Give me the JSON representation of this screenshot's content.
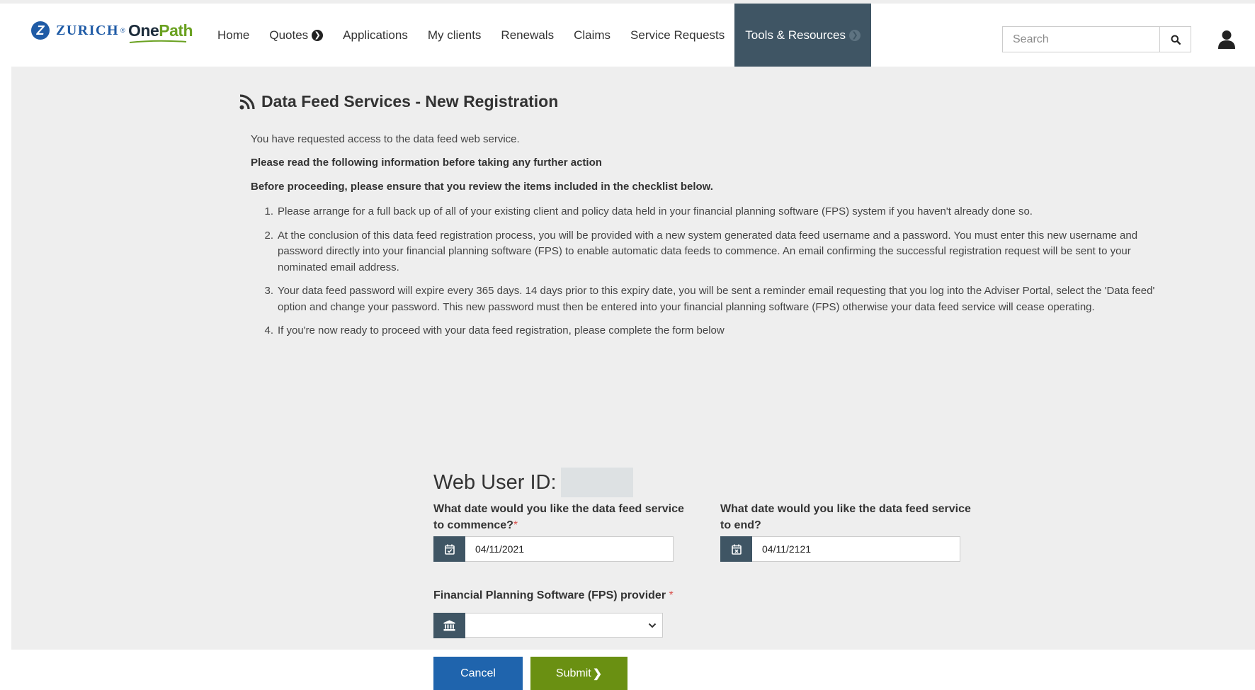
{
  "brand": {
    "zurich_mark": "Z",
    "zurich_name": "ZURICH",
    "zurich_reg": "®",
    "onepath_one": "One",
    "onepath_path": "Path",
    "zurich_color": "#1f5ba6",
    "onepath_green": "#6aa121"
  },
  "nav": {
    "items": [
      {
        "label": "Home"
      },
      {
        "label": "Quotes",
        "has_arrow": true
      },
      {
        "label": "Applications"
      },
      {
        "label": "My clients"
      },
      {
        "label": "Renewals"
      },
      {
        "label": "Claims"
      },
      {
        "label": "Service Requests"
      },
      {
        "label": "Tools & Resources",
        "has_arrow": true,
        "active": true
      }
    ],
    "active_color": "#3f5564"
  },
  "search": {
    "placeholder": "Search",
    "icon": "search-icon"
  },
  "user": {
    "icon": "user-icon"
  },
  "page": {
    "title": "Data Feed Services - New Registration",
    "title_icon": "rss-icon",
    "intro": "You have requested access to the data feed web service.",
    "notice": "Please read the following information before taking any further action",
    "checklist_heading": "Before proceeding, please ensure that you review the items included in the checklist below.",
    "checklist": [
      {
        "num": "1.",
        "text": "Please arrange for a full back up of all of your existing client and policy data held in your financial planning software (FPS) system if you haven't already done so."
      },
      {
        "num": "2.",
        "text": "At the conclusion of this data feed registration process, you will be provided with a new system generated data feed username and a password. You must enter this new username and password directly into your financial planning software (FPS) to enable automatic data feeds to commence. An email confirming the successful registration request will be sent to your nominated email address."
      },
      {
        "num": "3.",
        "text": "Your data feed password will expire every 365 days. 14 days prior to this expiry date, you will be sent a reminder email requesting that you log into the Adviser Portal, select the 'Data feed' option and change your password. This new password must then be entered into your financial planning software (FPS) otherwise your data feed service will cease operating."
      },
      {
        "num": "4.",
        "text": "If you're now ready to proceed with your data feed registration, please complete the form below"
      }
    ]
  },
  "form": {
    "web_user_label": "Web User ID:",
    "web_user_value": "",
    "start_label": "What date would you like the data feed service to commence?",
    "start_required": "*",
    "start_value": "04/11/2021",
    "start_icon": "calendar-check-icon",
    "end_label": "What date would you like the data feed service to end?",
    "end_value": "04/11/2121",
    "end_icon": "calendar-times-icon",
    "fps_label": "Financial Planning Software (FPS) provider",
    "fps_required": "*",
    "fps_value": "",
    "fps_icon": "bank-icon",
    "cancel_label": "Cancel",
    "submit_label": "Submit",
    "cancel_color": "#1f64ad",
    "submit_color": "#6a9012"
  }
}
